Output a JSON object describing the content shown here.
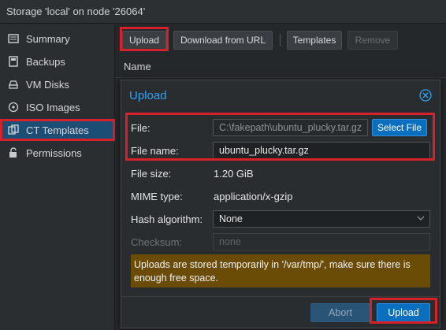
{
  "window": {
    "title": "Storage 'local' on node '26064'"
  },
  "sidebar": {
    "items": [
      {
        "label": "Summary",
        "icon": "summary-icon"
      },
      {
        "label": "Backups",
        "icon": "backups-icon"
      },
      {
        "label": "VM Disks",
        "icon": "vm-disks-icon"
      },
      {
        "label": "ISO Images",
        "icon": "iso-images-icon"
      },
      {
        "label": "CT Templates",
        "icon": "ct-templates-icon",
        "active": true
      },
      {
        "label": "Permissions",
        "icon": "permissions-icon"
      }
    ]
  },
  "toolbar": {
    "upload": "Upload",
    "download_url": "Download from URL",
    "templates": "Templates",
    "remove": "Remove"
  },
  "grid": {
    "column_name": "Name"
  },
  "dialog": {
    "title": "Upload",
    "file": {
      "label": "File:",
      "value": "C:\\fakepath\\ubuntu_plucky.tar.gz",
      "button": "Select File"
    },
    "file_name": {
      "label": "File name:",
      "value": "ubuntu_plucky.tar.gz"
    },
    "file_size": {
      "label": "File size:",
      "value": "1.20 GiB"
    },
    "mime_type": {
      "label": "MIME type:",
      "value": "application/x-gzip"
    },
    "hash_algorithm": {
      "label": "Hash algorithm:",
      "value": "None"
    },
    "checksum": {
      "label": "Checksum:",
      "placeholder": "none"
    },
    "notice": "Uploads are stored temporarily in '/var/tmp/', make sure there is enough free space.",
    "abort": "Abort",
    "upload": "Upload"
  },
  "colors": {
    "accent": "#2ea3f2",
    "primary_button": "#0b6fbf",
    "highlight_box": "#d6212a",
    "notice_bg": "#6b4c06"
  }
}
